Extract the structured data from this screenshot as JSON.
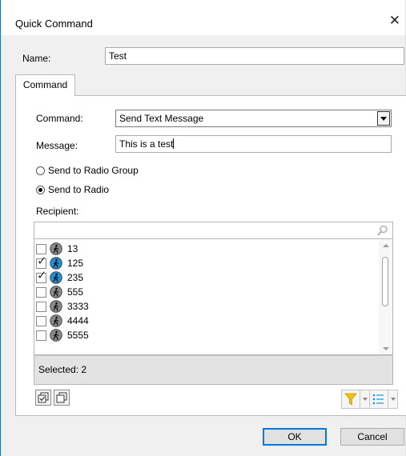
{
  "window": {
    "title": "Quick Command"
  },
  "name_field": {
    "label": "Name:",
    "value": "Test"
  },
  "tabs": [
    {
      "label": "Command"
    }
  ],
  "command_field": {
    "label": "Command:",
    "value": "Send Text Message"
  },
  "message_field": {
    "label": "Message:",
    "value": "This is a test"
  },
  "send_options": [
    {
      "label": "Send to Radio Group",
      "selected": false
    },
    {
      "label": "Send to Radio",
      "selected": true
    }
  ],
  "recipient": {
    "label": "Recipient:",
    "search_value": "",
    "items": [
      {
        "label": "13",
        "checked": false,
        "status": "offline"
      },
      {
        "label": "125",
        "checked": true,
        "status": "online"
      },
      {
        "label": "235",
        "checked": true,
        "status": "online"
      },
      {
        "label": "555",
        "checked": false,
        "status": "offline"
      },
      {
        "label": "3333",
        "checked": false,
        "status": "offline"
      },
      {
        "label": "4444",
        "checked": false,
        "status": "offline"
      },
      {
        "label": "5555",
        "checked": false,
        "status": "offline"
      }
    ],
    "selected_text": "Selected: 2"
  },
  "colors": {
    "online": "#1e8fd8",
    "offline": "#8a8a8a",
    "filter": "#f2c000",
    "accent": "#0078d7"
  },
  "buttons": {
    "ok": "OK",
    "cancel": "Cancel"
  }
}
